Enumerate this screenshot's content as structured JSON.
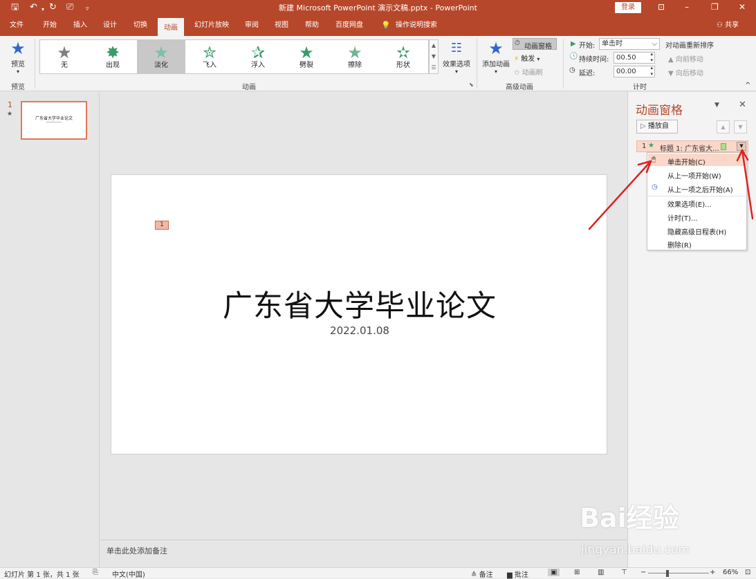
{
  "app": {
    "document_title": "新建 Microsoft PowerPoint 演示文稿.pptx - PowerPoint",
    "login": "登录",
    "share": "共享",
    "tell_me": "操作说明搜索"
  },
  "tabs": [
    "文件",
    "开始",
    "插入",
    "设计",
    "切换",
    "动画",
    "幻灯片放映",
    "审阅",
    "视图",
    "帮助",
    "百度网盘"
  ],
  "ribbon": {
    "preview": {
      "label": "预览",
      "group": "预览"
    },
    "gallery": [
      {
        "label": "无",
        "color": "#7f7f7f"
      },
      {
        "label": "出现",
        "color": "#3b9b6b"
      },
      {
        "label": "淡化",
        "color": "#7fbfa4"
      },
      {
        "label": "飞入",
        "color": "#3b9b6b"
      },
      {
        "label": "浮入",
        "color": "#3b9b6b"
      },
      {
        "label": "劈裂",
        "color": "#3b9b6b"
      },
      {
        "label": "擦除",
        "color": "#6fb592"
      },
      {
        "label": "形状",
        "color": "#3b9b6b"
      }
    ],
    "effect_options": "效果选项",
    "anim_group": "动画",
    "add_animation": "添加动画",
    "anim_pane_btn": "动画窗格",
    "trigger": "触发",
    "anim_painter": "动画刷",
    "advanced_group": "高级动画",
    "start_label": "开始:",
    "start_value": "单击时",
    "duration_label": "持续时间:",
    "duration_value": "00.50",
    "delay_label": "延迟:",
    "delay_value": "00.00",
    "reorder": "对动画重新排序",
    "move_earlier": "向前移动",
    "move_later": "向后移动",
    "timing_group": "计时"
  },
  "slides": {
    "number": "1",
    "thumb_title": "广东省大学毕业论文"
  },
  "slide": {
    "title": "广东省大学毕业论文",
    "subtitle": "2022.01.08",
    "anim_tag": "1"
  },
  "notes": "单击此处添加备注",
  "anim_pane": {
    "title": "动画窗格",
    "play_from": "播放自",
    "item_index": "1",
    "item_label": "标题 1: 广东省大..."
  },
  "context_menu": [
    "单击开始(C)",
    "从上一项开始(W)",
    "从上一项之后开始(A)",
    "效果选项(E)...",
    "计时(T)...",
    "隐藏高级日程表(H)",
    "删除(R)"
  ],
  "status": {
    "slide_info": "幻灯片 第 1 张，共 1 张",
    "language": "中文(中国)",
    "notes_btn": "备注",
    "comments_btn": "批注",
    "zoom": "66%"
  },
  "watermark": {
    "logo": "Bai经验",
    "url": "jingyan.baidu.com"
  },
  "colors": {
    "accent": "#b7472a",
    "arrow": "#e02020"
  }
}
